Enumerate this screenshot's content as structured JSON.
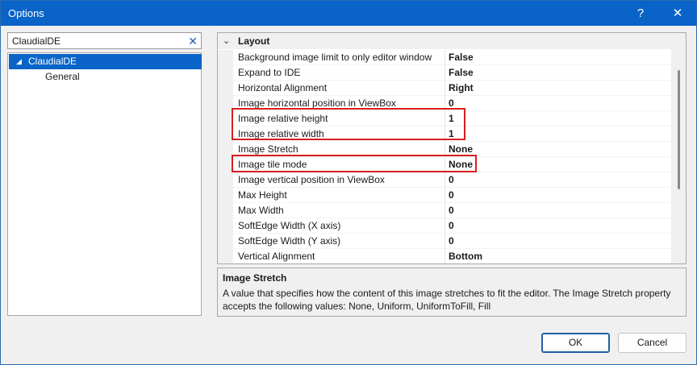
{
  "window": {
    "title": "Options",
    "help_glyph": "?",
    "close_glyph": "✕"
  },
  "search": {
    "value": "ClaudialDE",
    "clear_glyph": "✕"
  },
  "tree": {
    "items": [
      {
        "label": "ClaudialDE",
        "expanded": true,
        "selected": true,
        "arrow": "◢"
      },
      {
        "label": "General",
        "selected": false
      }
    ]
  },
  "grid": {
    "category": {
      "label": "Layout",
      "chevron": "⌄"
    },
    "properties": [
      {
        "name": "Background image limit to only editor window",
        "value": "False"
      },
      {
        "name": "Expand to IDE",
        "value": "False"
      },
      {
        "name": "Horizontal Alignment",
        "value": "Right"
      },
      {
        "name": "Image horizontal position in ViewBox",
        "value": "0"
      },
      {
        "name": "Image relative height",
        "value": "1"
      },
      {
        "name": "Image relative width",
        "value": "1"
      },
      {
        "name": "Image Stretch",
        "value": "None"
      },
      {
        "name": "Image tile mode",
        "value": "None"
      },
      {
        "name": "Image vertical position in ViewBox",
        "value": "0"
      },
      {
        "name": "Max Height",
        "value": "0"
      },
      {
        "name": "Max Width",
        "value": "0"
      },
      {
        "name": "SoftEdge Width (X axis)",
        "value": "0"
      },
      {
        "name": "SoftEdge Width (Y axis)",
        "value": "0"
      },
      {
        "name": "Vertical Alignment",
        "value": "Bottom"
      }
    ]
  },
  "description": {
    "title": "Image Stretch",
    "body": "A value that specifies how the content of this image stretches to fit the editor. The Image Stretch property accepts the following values: None, Uniform, UniformToFill, Fill"
  },
  "buttons": {
    "ok": "OK",
    "cancel": "Cancel"
  },
  "colors": {
    "titlebar": "#0a64c8",
    "selection": "#0a64c8",
    "highlight_box": "#d91e1e"
  }
}
